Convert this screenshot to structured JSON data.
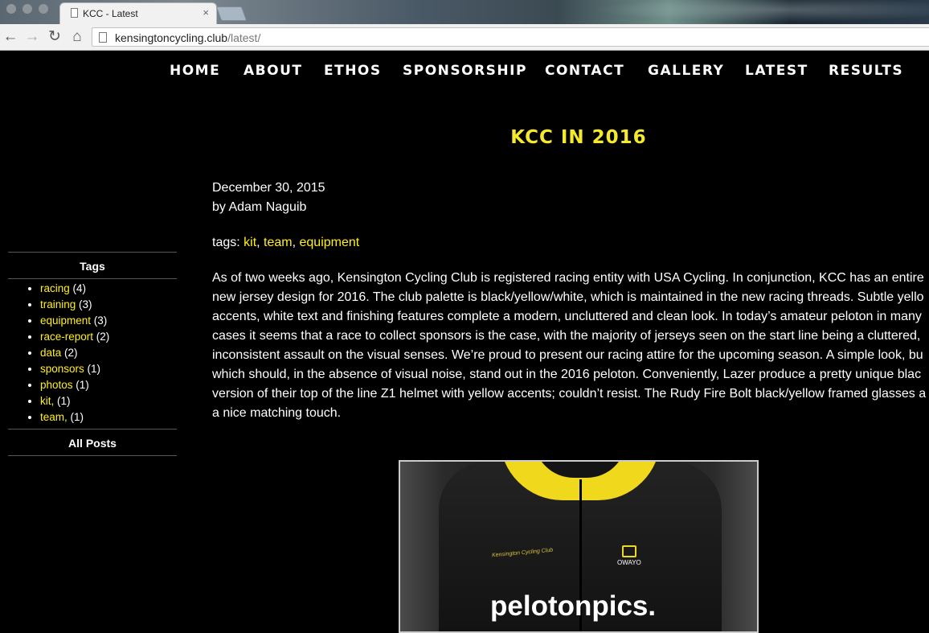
{
  "browser": {
    "tab_title": "KCC - Latest",
    "tab_close": "×",
    "url_host": "kensingtoncycling.club",
    "url_path": "/latest/",
    "back": "←",
    "forward": "→",
    "reload": "↻",
    "home": "⌂"
  },
  "nav": {
    "items": [
      "HOME",
      "ABOUT",
      "ETHOS",
      "SPONSORSHIP",
      "CONTACT",
      "GALLERY",
      "LATEST",
      "RESULTS"
    ]
  },
  "sidebar": {
    "tags_heading": "Tags",
    "tags": [
      {
        "name": "racing",
        "count": " (4)"
      },
      {
        "name": "training",
        "count": " (3)"
      },
      {
        "name": "equipment",
        "count": " (3)"
      },
      {
        "name": "race-report",
        "count": " (2)"
      },
      {
        "name": "data",
        "count": " (2)"
      },
      {
        "name": "sponsors",
        "count": " (1)"
      },
      {
        "name": "photos",
        "count": " (1)"
      },
      {
        "name": "kit,",
        "count": " (1)"
      },
      {
        "name": "team,",
        "count": " (1)"
      }
    ],
    "all_posts": "All Posts"
  },
  "post": {
    "title": "KCC IN 2016",
    "date": "December 30, 2015",
    "author": "by Adam Naguib",
    "tags_label": "tags: ",
    "tags": [
      "kit",
      "team",
      "equipment"
    ],
    "tag_sep": ", ",
    "body_lines": [
      "As of two weeks ago, Kensington Cycling Club is registered racing entity with USA Cycling. In conjunction, KCC has an entire",
      "new jersey design for 2016. The club palette is black/yellow/white, which is maintained in the new racing threads. Subtle yello",
      "accents, white text and finishing features complete a modern, uncluttered and clean look. In today’s amateur peloton in many",
      "cases it seems that a race to collect sponsors is the case, with the majority of jerseys seen on the start line being a cluttered,",
      "inconsistent assault on the visual senses. We’re proud to present our racing attire for the upcoming season. A simple look, bu",
      "which should, in the absence of visual noise, stand out in the 2016 peloton. Conveniently, Lazer produce a pretty unique blac",
      "version of their top of the line Z1 helmet with yellow accents; couldn’t resist. The Rudy Fire Bolt black/yellow framed glasses a",
      "a nice matching touch."
    ],
    "image": {
      "club_text": "Kensington Cycling Club",
      "owayo": "OWAYO",
      "sponsor": "pelotonpics."
    }
  },
  "colors": {
    "accent": "#ffef1a",
    "title": "#f5e92b",
    "background": "#000000"
  }
}
